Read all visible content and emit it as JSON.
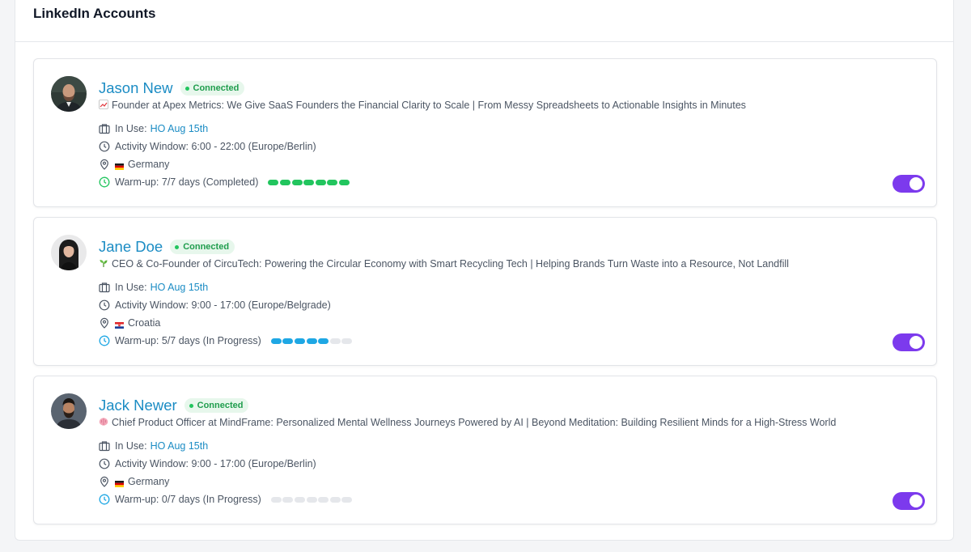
{
  "page": {
    "title": "LinkedIn Accounts"
  },
  "colors": {
    "accent": "#7c3aed",
    "link": "#1b8cc4",
    "connected": "#22c55e",
    "warmup_complete": "#22c55e",
    "warmup_progress": "#1ea7e4",
    "warmup_empty": "#e5e7eb"
  },
  "accounts": [
    {
      "name": "Jason New",
      "status": "Connected",
      "headline_icon": "chart-emoji-icon",
      "headline": "Founder at Apex Metrics: We Give SaaS Founders the Financial Clarity to Scale | From Messy Spreadsheets to Actionable Insights in Minutes",
      "in_use_label": "In Use:",
      "in_use_value": "HO Aug 15th",
      "activity_window": "Activity Window: 6:00 - 22:00 (Europe/Berlin)",
      "country": "Germany",
      "country_flag": "germany-flag-icon",
      "warmup": "Warm-up: 7/7 days (Completed)",
      "warmup_done": 7,
      "warmup_total": 7,
      "warmup_state": "completed",
      "enabled": true
    },
    {
      "name": "Jane Doe",
      "status": "Connected",
      "headline_icon": "seedling-emoji-icon",
      "headline": "CEO & Co-Founder of CircuTech: Powering the Circular Economy with Smart Recycling Tech | Helping Brands Turn Waste into a Resource, Not Landfill",
      "in_use_label": "In Use:",
      "in_use_value": "HO Aug 15th",
      "activity_window": "Activity Window: 9:00 - 17:00 (Europe/Belgrade)",
      "country": "Croatia",
      "country_flag": "croatia-flag-icon",
      "warmup": "Warm-up: 5/7 days (In Progress)",
      "warmup_done": 5,
      "warmup_total": 7,
      "warmup_state": "in-progress",
      "enabled": true
    },
    {
      "name": "Jack Newer",
      "status": "Connected",
      "headline_icon": "brain-emoji-icon",
      "headline": "Chief Product Officer at MindFrame: Personalized Mental Wellness Journeys Powered by AI | Beyond Meditation: Building Resilient Minds for a High-Stress World",
      "in_use_label": "In Use:",
      "in_use_value": "HO Aug 15th",
      "activity_window": "Activity Window: 9:00 - 17:00 (Europe/Berlin)",
      "country": "Germany",
      "country_flag": "germany-flag-icon",
      "warmup": "Warm-up: 0/7 days (In Progress)",
      "warmup_done": 0,
      "warmup_total": 7,
      "warmup_state": "in-progress",
      "enabled": true
    }
  ]
}
